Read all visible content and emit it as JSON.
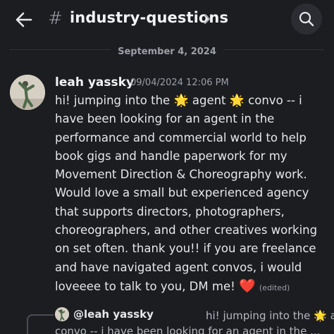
{
  "header": {
    "hash_symbol": "#",
    "channel_name": "industry-questions",
    "icons": {
      "back": "arrow-left-icon",
      "chevron": "chevron-right-icon",
      "search": "search-icon"
    }
  },
  "date_divider": {
    "label": "September 4, 2024"
  },
  "message": {
    "author": "leah yassky",
    "timestamp": "09/04/2024 12:06 PM",
    "text_part1": "hi! jumping into the ",
    "emoji1": "🌟",
    "text_part2": " agent ",
    "emoji2": "🌟",
    "text_part3": "  convo -- i have been looking for an agent in the performance and commercial world to help book gigs and handle paperwork for my Movement Direction & Choreography work. Would love a small but experienced agency that supports directors, photographers, choreographers, and other creatives working on set often. thank you!! if you are freelance and have navigated agent convos, i would loveeee to talk to you,  DM me! ",
    "heart": "❤️",
    "edited": "(edited)"
  },
  "reply": {
    "author": "@leah yassky",
    "line1_a": "hi! jumping into the ",
    "emoji1": "🌟",
    "line1_b": " agent ",
    "emoji2": "🌟",
    "line2": "convo -- i have been looking for an agent in the ..."
  },
  "colors": {
    "background": "#1b1d21",
    "heart": "#e0303e",
    "muted": "#9c9fa6"
  }
}
